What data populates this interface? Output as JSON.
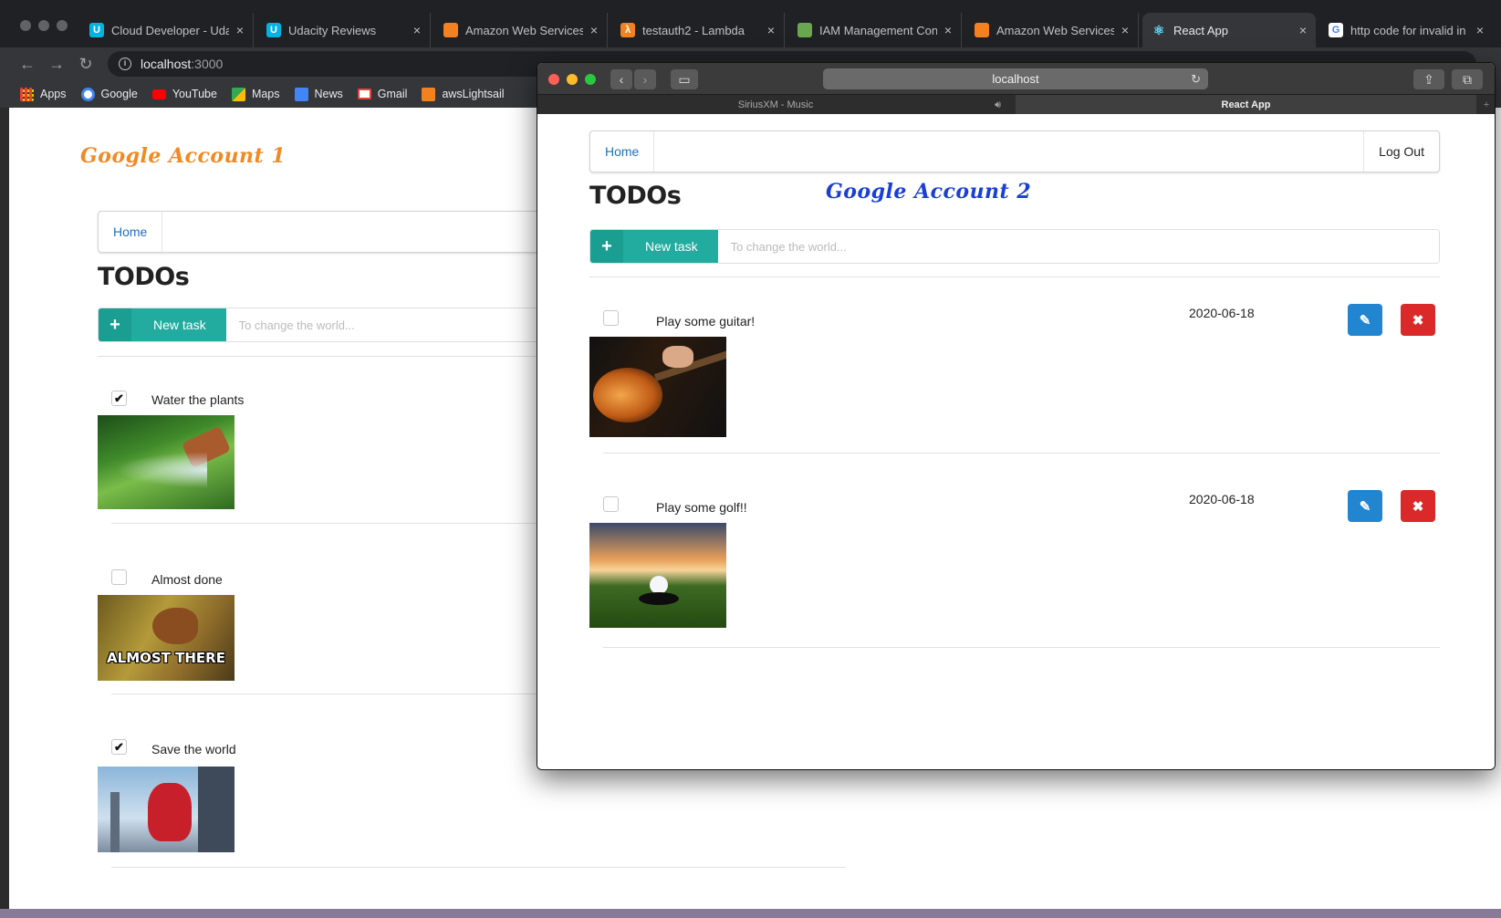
{
  "chrome": {
    "tabs": [
      {
        "title": "Cloud Developer - Uda",
        "icon": "udacity-icon",
        "color": "#02b3e4"
      },
      {
        "title": "Udacity Reviews",
        "icon": "udacity-icon",
        "color": "#02b3e4"
      },
      {
        "title": "Amazon Web Services",
        "icon": "aws-cube-icon",
        "color": "#f4811f"
      },
      {
        "title": "testauth2 - Lambda",
        "icon": "lambda-icon",
        "color": "#f4811f"
      },
      {
        "title": "IAM Management Con",
        "icon": "iam-icon",
        "color": "#6aa84f"
      },
      {
        "title": "Amazon Web Services",
        "icon": "aws-cube-icon",
        "color": "#f4811f"
      },
      {
        "title": "React App",
        "icon": "react-icon",
        "color": "#61dafb"
      },
      {
        "title": "http code for invalid in",
        "icon": "google-icon",
        "color": "#4285f4"
      }
    ],
    "close_glyph": "×",
    "url_host": "localhost",
    "url_port": ":3000",
    "bookmarks": [
      {
        "label": "Apps",
        "icon": "apps-grid-icon",
        "color": "#e94235"
      },
      {
        "label": "Google",
        "icon": "google-icon",
        "color": "#4285f4"
      },
      {
        "label": "YouTube",
        "icon": "youtube-icon",
        "color": "#ff0000"
      },
      {
        "label": "Maps",
        "icon": "maps-icon",
        "color": "#34a853"
      },
      {
        "label": "News",
        "icon": "news-icon",
        "color": "#4285f4"
      },
      {
        "label": "Gmail",
        "icon": "gmail-icon",
        "color": "#ea4335"
      },
      {
        "label": "awsLightsail",
        "icon": "aws-cube-icon",
        "color": "#f4811f"
      }
    ]
  },
  "left_app": {
    "annotation": "Google Account 1",
    "annotation_color": "#f08a24",
    "nav": {
      "home": "Home"
    },
    "heading": "TODOs",
    "new_task": {
      "label": "New task",
      "placeholder": "To change the world..."
    },
    "todos": [
      {
        "name": "Water the plants",
        "done": true,
        "image": "garden-hose-watering-plants"
      },
      {
        "name": "Almost done",
        "done": false,
        "image": "squirrel-meme",
        "caption": "ALMOST THERE"
      },
      {
        "name": "Save the world",
        "done": true,
        "image": "spiderman-skyline"
      }
    ]
  },
  "safari": {
    "url": "localhost",
    "tabs": [
      {
        "title": "SiriusXM - Music"
      },
      {
        "title": "React App"
      }
    ]
  },
  "right_app": {
    "annotation": "Google Account 2",
    "annotation_color": "#1a3fd6",
    "nav": {
      "home": "Home",
      "logout": "Log Out"
    },
    "heading": "TODOs",
    "new_task": {
      "label": "New task",
      "placeholder": "To change the world..."
    },
    "todos": [
      {
        "name": "Play some guitar!",
        "done": false,
        "date": "2020-06-18",
        "image": "guitar-player"
      },
      {
        "name": "Play some golf!!",
        "done": false,
        "date": "2020-06-18",
        "image": "golf-ball-at-hole"
      }
    ]
  },
  "colors": {
    "teal": "#21ac9f",
    "edit_blue": "#2185d0",
    "delete_red": "#db2828"
  }
}
